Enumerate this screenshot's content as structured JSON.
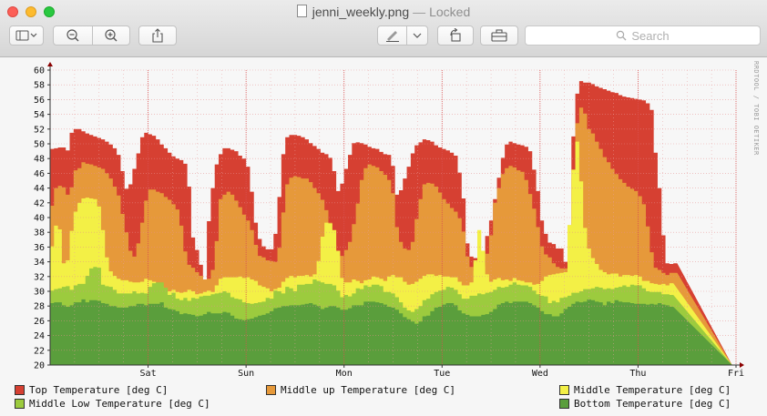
{
  "window": {
    "filename": "jenni_weekly.png",
    "separator": "—",
    "status": "Locked"
  },
  "toolbar": {
    "buttons": [
      "sidebar-toggle",
      "zoom-out",
      "zoom-in",
      "share",
      "markup",
      "rotate",
      "toolbox"
    ],
    "search_placeholder": "Search"
  },
  "side_label": "RRDTOOL / TOBI OETIKER",
  "colors": {
    "top": "#d64032",
    "midup": "#e6993a",
    "middle": "#f3f046",
    "midlow": "#9ccb3e",
    "bottom": "#5a9e3c"
  },
  "chart_data": {
    "type": "area",
    "title": "",
    "xlabel": "",
    "ylabel": "",
    "ylim": [
      20,
      60
    ],
    "yticks": [
      20,
      22,
      24,
      26,
      28,
      30,
      32,
      34,
      36,
      38,
      40,
      42,
      44,
      46,
      48,
      50,
      52,
      54,
      56,
      58,
      60
    ],
    "xticks": [
      "Sat",
      "Sun",
      "Mon",
      "Tue",
      "Wed",
      "Thu",
      "Fri"
    ],
    "grid": true,
    "legend_position": "bottom",
    "x": [
      0.0,
      0.04,
      0.08,
      0.12,
      0.16,
      0.2,
      0.24,
      0.28,
      0.32,
      0.36,
      0.4,
      0.44,
      0.48,
      0.52,
      0.56,
      0.6,
      0.64,
      0.68,
      0.72,
      0.76,
      0.8,
      0.84,
      0.88,
      0.92,
      0.96,
      1.0,
      1.04,
      1.08,
      1.12,
      1.16,
      1.2,
      1.24,
      1.28,
      1.32,
      1.36,
      1.4,
      1.44,
      1.48,
      1.52,
      1.56,
      1.6,
      1.64,
      1.68,
      1.72,
      1.76,
      1.8,
      1.84,
      1.88,
      1.92,
      1.96,
      2.0,
      2.04,
      2.08,
      2.12,
      2.16,
      2.2,
      2.24,
      2.28,
      2.32,
      2.36,
      2.4,
      2.44,
      2.48,
      2.52,
      2.56,
      2.6,
      2.64,
      2.68,
      2.72,
      2.76,
      2.8,
      2.84,
      2.88,
      2.92,
      2.96,
      3.0,
      3.04,
      3.08,
      3.12,
      3.16,
      3.2,
      3.24,
      3.28,
      3.32,
      3.36,
      3.4,
      3.44,
      3.48,
      3.52,
      3.56,
      3.6,
      3.64,
      3.68,
      3.72,
      3.76,
      3.8,
      3.84,
      3.88,
      3.92,
      3.96,
      4.0,
      4.04,
      4.08,
      4.12,
      4.16,
      4.2,
      4.24,
      4.28,
      4.32,
      4.36,
      4.4,
      4.44,
      4.48,
      4.52,
      4.56,
      4.6,
      4.64,
      4.68,
      4.72,
      4.76,
      4.8,
      4.84,
      4.88,
      4.92,
      4.96,
      5.0,
      5.04,
      5.08,
      5.12,
      5.16,
      5.2,
      5.24,
      5.28,
      5.32,
      5.36,
      5.4,
      5.44,
      5.48,
      5.52,
      5.56,
      5.6,
      5.64,
      5.68,
      5.72,
      5.76,
      5.8,
      5.84,
      5.88,
      5.92,
      5.96,
      6.0,
      6.04,
      6.08,
      6.12,
      6.16,
      6.2,
      6.24,
      6.28,
      6.32,
      6.36,
      6.4,
      6.44,
      6.48,
      6.52,
      6.56,
      6.6,
      6.64,
      6.68,
      6.72,
      6.76,
      6.8,
      6.84,
      6.88,
      6.92
    ],
    "series": [
      {
        "name": "Top Temperature [deg C]",
        "key": "top",
        "values": [
          49.3,
          49.4,
          49.5,
          49.5,
          49.1,
          51.5,
          52.0,
          52.0,
          51.7,
          51.4,
          51.2,
          51.0,
          50.8,
          50.6,
          50.3,
          49.9,
          49.4,
          48.5,
          46.3,
          43.9,
          44.5,
          46.6,
          48.7,
          50.9,
          51.5,
          51.3,
          51.1,
          50.6,
          49.9,
          49.4,
          48.8,
          48.3,
          48.0,
          47.8,
          47.3,
          44.2,
          37.3,
          35.6,
          33.6,
          31.2,
          39.5,
          44.0,
          47.2,
          48.6,
          49.4,
          49.4,
          49.2,
          49.0,
          48.4,
          48.0,
          46.9,
          43.5,
          39.3,
          37.1,
          36.1,
          35.7,
          35.7,
          37.8,
          42.8,
          48.6,
          50.9,
          51.2,
          51.2,
          51.1,
          50.9,
          50.6,
          50.1,
          49.7,
          49.3,
          48.8,
          48.6,
          48.1,
          46.3,
          43.6,
          44.6,
          46.6,
          48.5,
          50.1,
          50.2,
          50.1,
          49.9,
          49.6,
          49.4,
          49.3,
          48.9,
          48.6,
          48.5,
          47.0,
          43.1,
          43.7,
          45.3,
          46.9,
          48.7,
          49.8,
          50.2,
          50.6,
          50.5,
          50.3,
          49.8,
          49.5,
          49.3,
          49.1,
          48.8,
          48.4,
          46.1,
          42.6,
          36.5,
          34.7,
          34.5,
          34.7,
          34.5,
          37.5,
          39.6,
          42.5,
          45.4,
          48.1,
          49.9,
          50.3,
          50.1,
          49.9,
          49.8,
          49.6,
          49.0,
          46.5,
          43.6,
          39.6,
          37.8,
          36.6,
          36.4,
          35.8,
          35.8,
          34.0,
          35.0,
          51.0,
          56.8,
          58.5,
          58.3,
          58.3,
          58.1,
          57.8,
          57.6,
          57.4,
          57.2,
          57.0,
          56.9,
          56.6,
          56.4,
          56.3,
          56.2,
          56.1,
          56.0,
          55.9,
          55.5,
          54.6,
          48.8,
          44.0,
          37.6,
          33.8,
          33.7,
          33.8
        ]
      },
      {
        "name": "Middle up Temperature [deg C]",
        "key": "midup",
        "values": [
          41.6,
          44.0,
          44.3,
          44.1,
          43.1,
          44.1,
          46.4,
          46.7,
          47.5,
          47.3,
          47.2,
          47.0,
          46.8,
          46.6,
          46.0,
          45.3,
          44.2,
          43.0,
          40.5,
          38.0,
          35.5,
          34.7,
          36.5,
          39.3,
          42.3,
          43.8,
          43.8,
          43.5,
          43.3,
          42.8,
          42.4,
          41.8,
          41.1,
          38.9,
          35.4,
          33.6,
          33.2,
          32.6,
          32.1,
          31.6,
          31.7,
          32.9,
          36.8,
          42.5,
          43.1,
          43.5,
          43.1,
          42.3,
          41.4,
          40.4,
          39.6,
          38.3,
          36.3,
          34.8,
          34.6,
          34.2,
          34.1,
          34.0,
          35.9,
          40.7,
          44.5,
          45.4,
          45.6,
          45.5,
          45.3,
          45.3,
          44.8,
          44.0,
          43.3,
          42.4,
          41.0,
          39.3,
          36.3,
          34.6,
          34.8,
          35.6,
          36.7,
          39.1,
          41.9,
          45.1,
          46.7,
          47.2,
          47.0,
          46.8,
          46.3,
          45.8,
          45.1,
          43.3,
          38.7,
          36.7,
          35.8,
          35.6,
          36.7,
          39.8,
          42.5,
          44.5,
          44.7,
          44.6,
          44.2,
          43.4,
          42.5,
          41.9,
          41.3,
          40.8,
          39.9,
          38.1,
          34.7,
          33.3,
          32.8,
          32.9,
          33.4,
          35.1,
          37.6,
          42.0,
          44.0,
          45.9,
          46.7,
          47.0,
          46.8,
          46.4,
          46.2,
          45.1,
          43.2,
          41.2,
          38.7,
          36.1,
          35.0,
          34.6,
          33.8,
          33.3,
          33.1,
          33.1,
          33.3,
          45.3,
          52.8,
          54.9,
          54.1,
          52.0,
          51.4,
          50.3,
          49.3,
          48.2,
          47.5,
          46.6,
          45.9,
          45.2,
          44.7,
          44.2,
          43.9,
          43.6,
          42.9,
          41.8,
          38.8,
          35.3,
          33.2,
          32.9,
          32.5,
          32.2,
          32.5,
          32.5
        ]
      },
      {
        "name": "Middle Temperature [deg C]",
        "key": "middle",
        "values": [
          36.1,
          38.9,
          38.4,
          33.8,
          34.2,
          38.2,
          40.8,
          42.0,
          42.6,
          42.7,
          42.6,
          42.5,
          41.5,
          38.3,
          34.6,
          32.7,
          32.1,
          31.7,
          31.5,
          31.5,
          31.3,
          31.2,
          31.2,
          31.3,
          31.7,
          31.5,
          31.3,
          31.1,
          30.6,
          30.4,
          30.0,
          30.2,
          29.9,
          29.8,
          29.9,
          30.2,
          30.0,
          29.6,
          29.7,
          29.9,
          30.1,
          29.9,
          30.8,
          31.7,
          31.9,
          31.9,
          31.9,
          31.9,
          32.0,
          31.8,
          31.9,
          31.6,
          31.4,
          30.8,
          30.6,
          30.4,
          30.0,
          30.3,
          30.5,
          31.3,
          31.8,
          32.1,
          31.9,
          32.1,
          32.1,
          32.2,
          32.0,
          32.3,
          34.1,
          37.4,
          39.3,
          39.2,
          38.3,
          35.5,
          31.8,
          31.2,
          31.2,
          31.6,
          31.4,
          31.1,
          31.5,
          31.6,
          32.0,
          31.9,
          31.7,
          31.4,
          32.0,
          32.2,
          31.9,
          31.9,
          31.3,
          30.9,
          31.0,
          31.3,
          31.7,
          32.1,
          32.3,
          32.3,
          32.1,
          32.2,
          32.0,
          32.0,
          31.9,
          31.9,
          31.3,
          30.8,
          30.8,
          31.2,
          34.2,
          38.3,
          35.5,
          32.3,
          31.3,
          31.6,
          31.8,
          31.5,
          31.6,
          31.4,
          31.8,
          31.5,
          31.4,
          31.2,
          31.2,
          30.9,
          31.0,
          31.4,
          32.0,
          32.2,
          32.3,
          32.4,
          32.5,
          32.6,
          39.0,
          46.5,
          50.3,
          44.9,
          38.6,
          35.8,
          34.5,
          33.7,
          32.9,
          32.6,
          32.3,
          32.4,
          32.4,
          32.0,
          32.2,
          32.2,
          32.1,
          32.2,
          32.0,
          31.4,
          31.4,
          31.1,
          31.0,
          30.9,
          31.0,
          30.8,
          31.1
        ]
      },
      {
        "name": "Middle Low Temperature [deg C]",
        "key": "midlow",
        "values": [
          30.1,
          30.3,
          30.4,
          30.6,
          30.7,
          30.2,
          30.8,
          31.0,
          31.0,
          32.1,
          33.1,
          33.3,
          33.2,
          30.9,
          30.7,
          30.6,
          30.2,
          29.7,
          29.7,
          29.7,
          29.7,
          30.0,
          29.7,
          29.8,
          29.7,
          30.6,
          31.1,
          31.2,
          31.2,
          30.5,
          29.5,
          29.8,
          29.0,
          28.8,
          29.1,
          28.7,
          29.1,
          29.0,
          29.3,
          29.4,
          29.4,
          29.6,
          29.7,
          29.8,
          30.0,
          29.8,
          29.2,
          29.0,
          28.9,
          28.5,
          28.4,
          28.3,
          28.4,
          28.5,
          28.6,
          29.1,
          29.0,
          30.1,
          30.0,
          29.7,
          30.6,
          30.4,
          30.0,
          30.9,
          30.9,
          31.0,
          31.0,
          31.6,
          31.4,
          31.2,
          31.0,
          31.0,
          30.8,
          30.1,
          29.2,
          29.5,
          29.3,
          29.7,
          30.4,
          30.3,
          30.8,
          30.6,
          30.9,
          30.9,
          30.7,
          29.9,
          29.9,
          29.7,
          29.2,
          28.5,
          27.8,
          27.4,
          27.2,
          27.6,
          28.0,
          28.8,
          29.0,
          29.6,
          29.9,
          30.1,
          30.2,
          30.6,
          30.5,
          30.2,
          29.6,
          29.0,
          29.0,
          29.4,
          29.4,
          29.7,
          29.6,
          29.8,
          29.9,
          30.2,
          30.6,
          30.5,
          30.6,
          30.9,
          31.2,
          30.9,
          30.8,
          30.8,
          30.6,
          30.1,
          29.6,
          29.4,
          29.3,
          28.4,
          28.7,
          28.5,
          29.1,
          29.2,
          29.4,
          29.8,
          29.8,
          30.0,
          30.3,
          30.3,
          30.4,
          30.6,
          30.5,
          30.3,
          30.4,
          30.3,
          30.5,
          30.6,
          30.8,
          30.6,
          30.9,
          30.8,
          30.8,
          30.4,
          30.0,
          29.9,
          29.9,
          29.9,
          29.6,
          29.6,
          29.5
        ]
      },
      {
        "name": "Bottom Temperature [deg C]",
        "key": "bottom",
        "values": [
          28.4,
          28.5,
          28.5,
          28.1,
          27.9,
          28.1,
          28.5,
          28.5,
          28.9,
          28.5,
          28.8,
          28.8,
          28.7,
          28.4,
          28.3,
          28.0,
          28.0,
          27.8,
          27.8,
          27.8,
          28.0,
          28.0,
          28.3,
          28.3,
          28.1,
          28.3,
          28.3,
          28.3,
          28.5,
          27.8,
          27.6,
          27.5,
          27.3,
          26.9,
          27.0,
          26.9,
          26.8,
          26.6,
          26.7,
          26.9,
          27.2,
          27.0,
          27.0,
          27.0,
          27.2,
          27.1,
          26.7,
          26.3,
          26.2,
          26.1,
          26.2,
          26.3,
          26.5,
          26.7,
          26.8,
          27.0,
          27.3,
          27.7,
          27.8,
          28.0,
          28.0,
          28.1,
          28.1,
          28.1,
          28.2,
          28.3,
          28.4,
          28.2,
          28.0,
          27.6,
          27.8,
          28.0,
          28.0,
          27.8,
          27.5,
          27.5,
          27.7,
          28.1,
          28.1,
          28.1,
          28.6,
          28.6,
          28.6,
          28.5,
          28.4,
          28.2,
          27.9,
          27.8,
          27.5,
          27.0,
          26.5,
          26.2,
          25.9,
          25.6,
          25.9,
          26.6,
          26.7,
          27.3,
          27.8,
          27.9,
          28.2,
          28.4,
          28.4,
          28.1,
          27.4,
          27.0,
          26.8,
          26.6,
          26.6,
          26.6,
          26.8,
          26.9,
          27.2,
          27.6,
          28.2,
          28.4,
          28.6,
          28.4,
          28.6,
          28.6,
          28.6,
          28.6,
          28.4,
          28.1,
          27.8,
          27.3,
          26.9,
          26.9,
          26.6,
          26.6,
          27.0,
          27.6,
          27.9,
          28.3,
          28.6,
          28.5,
          28.6,
          28.9,
          28.8,
          28.6,
          28.5,
          28.1,
          28.6,
          28.4,
          28.8,
          28.6,
          28.5,
          28.5,
          28.4,
          28.3,
          28.3,
          28.3,
          28.2,
          28.3,
          28.2,
          28.4,
          28.2,
          28.1,
          27.9
        ]
      }
    ]
  }
}
